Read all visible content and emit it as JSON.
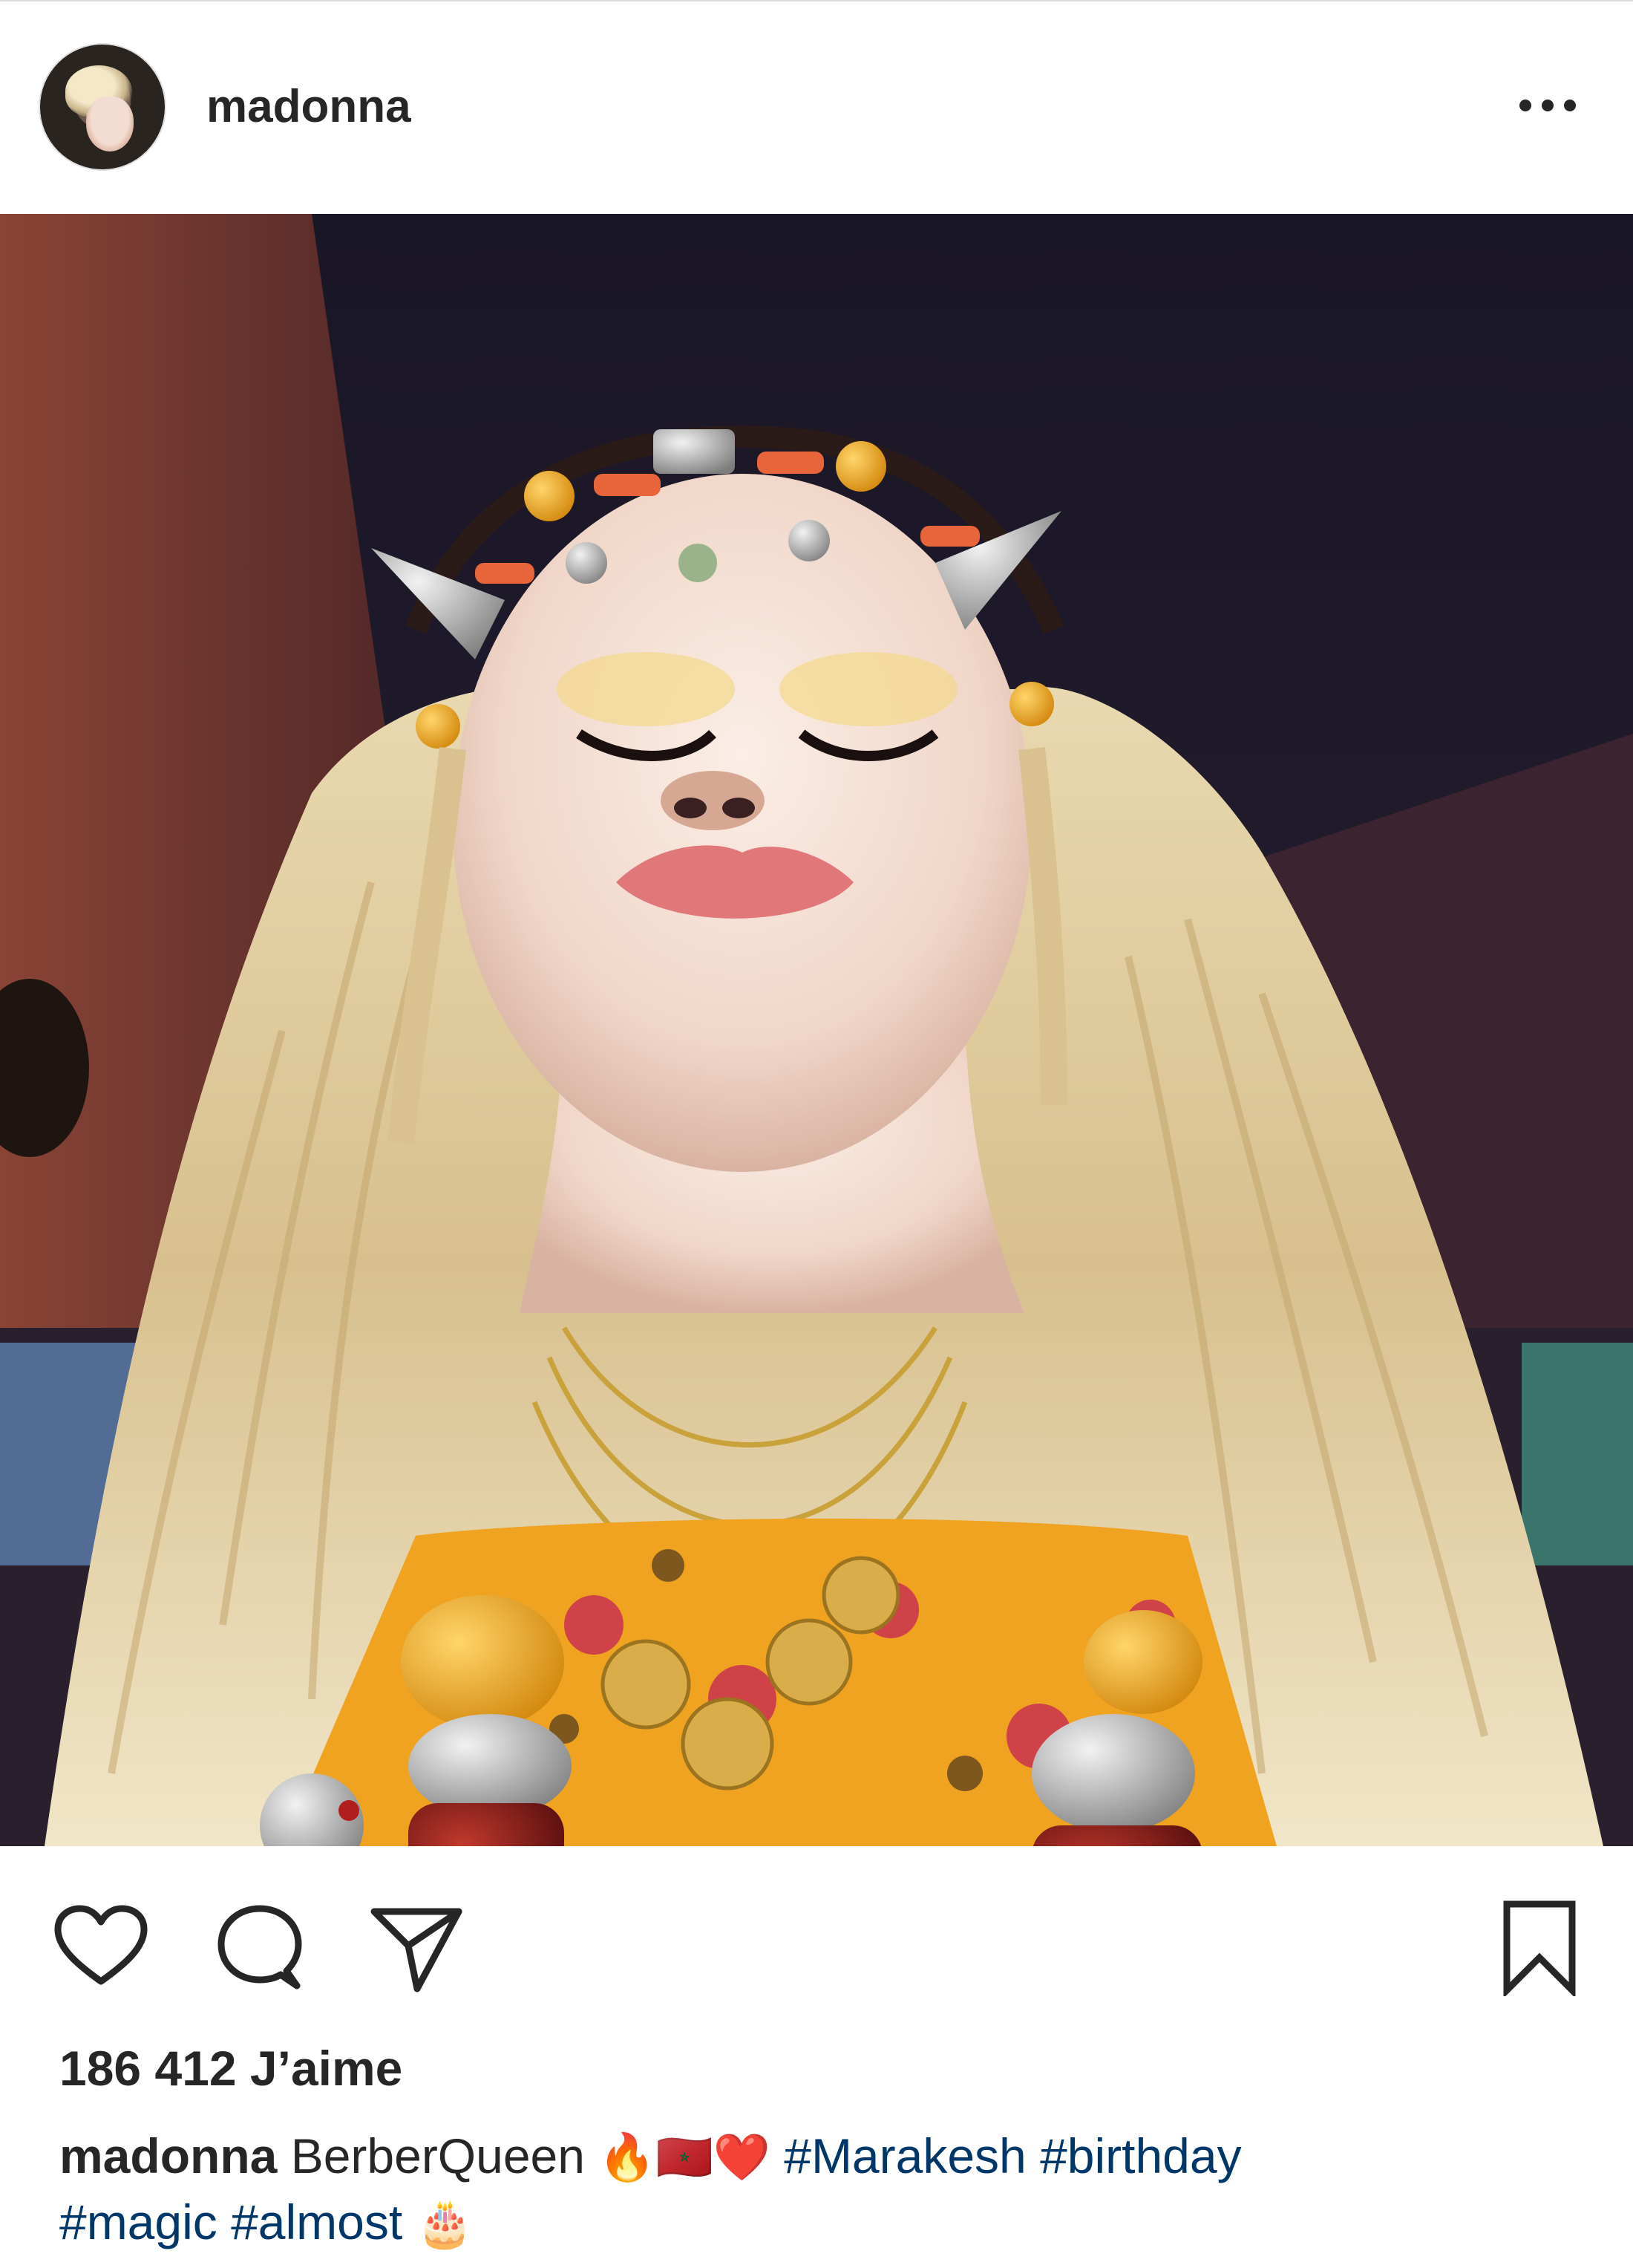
{
  "post": {
    "username": "madonna",
    "more_icon": "more-horizontal-icon",
    "likes_text": "186 412 J’aime",
    "caption": {
      "username": "madonna",
      "text": "BerberQueen",
      "emojis": "🔥🇲🇦❤️",
      "hashtags_line1": "#Marakesh #birthday",
      "hashtags_line2": "#magic #almost",
      "emoji_end": "🎂"
    },
    "actions": {
      "like_icon": "heart-icon",
      "comment_icon": "comment-icon",
      "share_icon": "paper-plane-icon",
      "save_icon": "bookmark-icon"
    },
    "colors": {
      "text": "#262626",
      "hashtag": "#00376b",
      "divider": "#dbdbdb"
    }
  }
}
